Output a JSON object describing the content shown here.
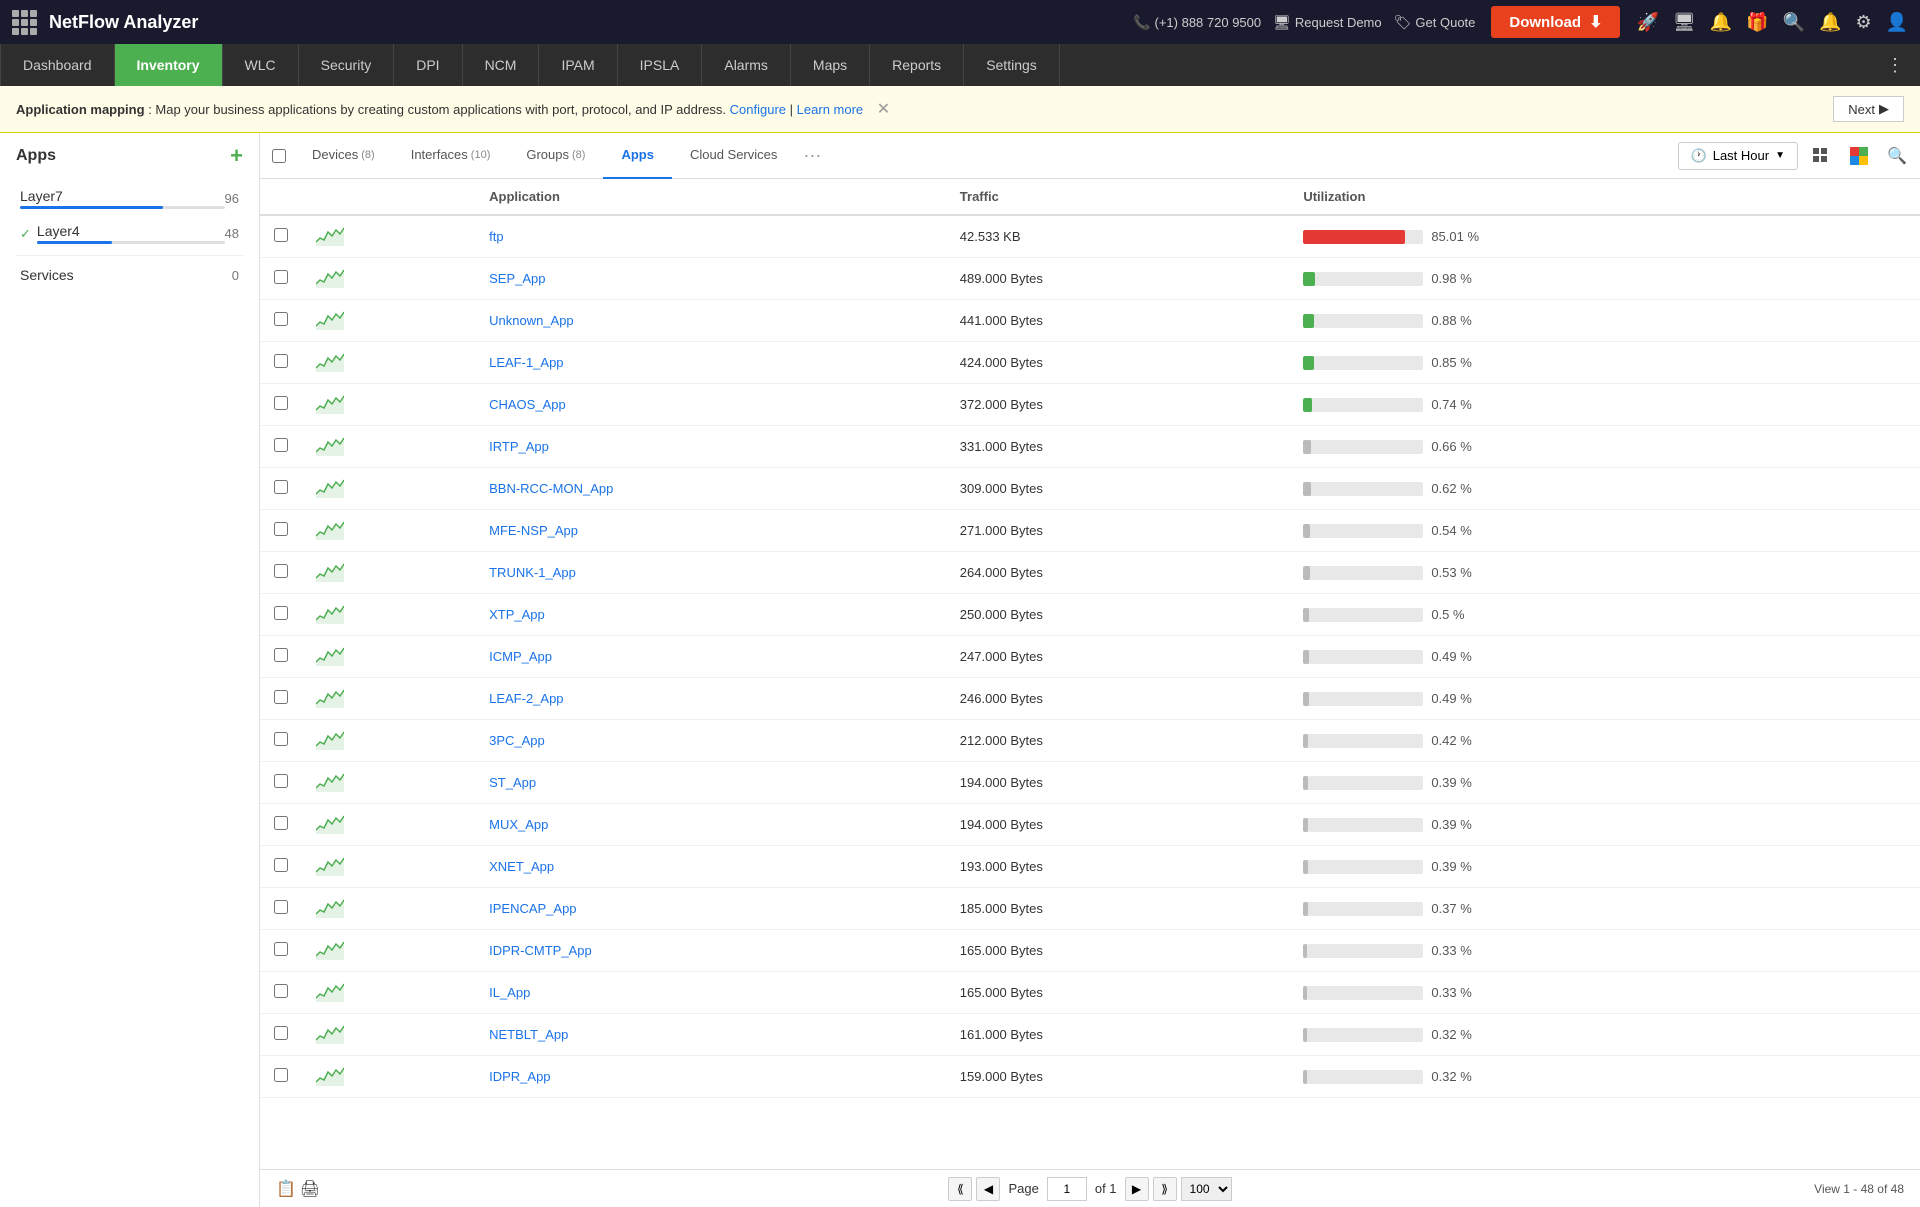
{
  "topbar": {
    "logo_text": "NetFlow Analyzer",
    "phone": "(+1) 888 720 9500",
    "demo_label": "Request Demo",
    "quote_label": "Get Quote",
    "download_label": "Download",
    "icons": [
      "rocket",
      "monitor",
      "bell-outline",
      "gift",
      "search",
      "bell",
      "gear",
      "user"
    ]
  },
  "navbar": {
    "items": [
      {
        "label": "Dashboard",
        "active": false
      },
      {
        "label": "Inventory",
        "active": true
      },
      {
        "label": "WLC",
        "active": false
      },
      {
        "label": "Security",
        "active": false
      },
      {
        "label": "DPI",
        "active": false
      },
      {
        "label": "NCM",
        "active": false
      },
      {
        "label": "IPAM",
        "active": false
      },
      {
        "label": "IPSLA",
        "active": false
      },
      {
        "label": "Alarms",
        "active": false
      },
      {
        "label": "Maps",
        "active": false
      },
      {
        "label": "Reports",
        "active": false
      },
      {
        "label": "Settings",
        "active": false
      }
    ]
  },
  "banner": {
    "bold": "Application mapping",
    "text": ": Map your business applications by creating custom applications with port, protocol, and IP address.",
    "configure": "Configure",
    "learn_more": "Learn more",
    "next_label": "Next"
  },
  "sidebar": {
    "title": "Apps",
    "add_tooltip": "+",
    "items": [
      {
        "label": "Layer7",
        "count": 96,
        "checked": false,
        "bar_pct": 70,
        "bar_color": "#1a73e8"
      },
      {
        "label": "Layer4",
        "count": 48,
        "checked": true,
        "bar_pct": 40,
        "bar_color": "#1a73e8"
      },
      {
        "label": "Services",
        "count": 0,
        "checked": false,
        "bar_pct": 0,
        "bar_color": "#1a73e8"
      }
    ]
  },
  "tabs": {
    "items": [
      {
        "label": "Devices",
        "badge": "(8)",
        "active": false
      },
      {
        "label": "Interfaces",
        "badge": "(10)",
        "active": false
      },
      {
        "label": "Groups",
        "badge": "(8)",
        "active": false
      },
      {
        "label": "Apps",
        "badge": "",
        "active": true
      },
      {
        "label": "Cloud Services",
        "badge": "",
        "active": false
      }
    ],
    "last_hour": "Last Hour",
    "more_label": "···"
  },
  "table": {
    "headers": [
      "",
      "",
      "Application",
      "Traffic",
      "Utilization"
    ],
    "rows": [
      {
        "name": "ftp",
        "traffic": "42.533 KB",
        "util_pct": 85.01,
        "util_label": "85.01 %",
        "bar_color": "#e53935"
      },
      {
        "name": "SEP_App",
        "traffic": "489.000 Bytes",
        "util_pct": 0.98,
        "util_label": "0.98 %",
        "bar_color": "#4caf50"
      },
      {
        "name": "Unknown_App",
        "traffic": "441.000 Bytes",
        "util_pct": 0.88,
        "util_label": "0.88 %",
        "bar_color": "#4caf50"
      },
      {
        "name": "LEAF-1_App",
        "traffic": "424.000 Bytes",
        "util_pct": 0.85,
        "util_label": "0.85 %",
        "bar_color": "#4caf50"
      },
      {
        "name": "CHAOS_App",
        "traffic": "372.000 Bytes",
        "util_pct": 0.74,
        "util_label": "0.74 %",
        "bar_color": "#4caf50"
      },
      {
        "name": "IRTP_App",
        "traffic": "331.000 Bytes",
        "util_pct": 0.66,
        "util_label": "0.66 %",
        "bar_color": "#bbb"
      },
      {
        "name": "BBN-RCC-MON_App",
        "traffic": "309.000 Bytes",
        "util_pct": 0.62,
        "util_label": "0.62 %",
        "bar_color": "#bbb"
      },
      {
        "name": "MFE-NSP_App",
        "traffic": "271.000 Bytes",
        "util_pct": 0.54,
        "util_label": "0.54 %",
        "bar_color": "#bbb"
      },
      {
        "name": "TRUNK-1_App",
        "traffic": "264.000 Bytes",
        "util_pct": 0.53,
        "util_label": "0.53 %",
        "bar_color": "#bbb"
      },
      {
        "name": "XTP_App",
        "traffic": "250.000 Bytes",
        "util_pct": 0.5,
        "util_label": "0.5 %",
        "bar_color": "#bbb"
      },
      {
        "name": "ICMP_App",
        "traffic": "247.000 Bytes",
        "util_pct": 0.49,
        "util_label": "0.49 %",
        "bar_color": "#bbb"
      },
      {
        "name": "LEAF-2_App",
        "traffic": "246.000 Bytes",
        "util_pct": 0.49,
        "util_label": "0.49 %",
        "bar_color": "#bbb"
      },
      {
        "name": "3PC_App",
        "traffic": "212.000 Bytes",
        "util_pct": 0.42,
        "util_label": "0.42 %",
        "bar_color": "#bbb"
      },
      {
        "name": "ST_App",
        "traffic": "194.000 Bytes",
        "util_pct": 0.39,
        "util_label": "0.39 %",
        "bar_color": "#bbb"
      },
      {
        "name": "MUX_App",
        "traffic": "194.000 Bytes",
        "util_pct": 0.39,
        "util_label": "0.39 %",
        "bar_color": "#bbb"
      },
      {
        "name": "XNET_App",
        "traffic": "193.000 Bytes",
        "util_pct": 0.39,
        "util_label": "0.39 %",
        "bar_color": "#bbb"
      },
      {
        "name": "IPENCAP_App",
        "traffic": "185.000 Bytes",
        "util_pct": 0.37,
        "util_label": "0.37 %",
        "bar_color": "#bbb"
      },
      {
        "name": "IDPR-CMTP_App",
        "traffic": "165.000 Bytes",
        "util_pct": 0.33,
        "util_label": "0.33 %",
        "bar_color": "#bbb"
      },
      {
        "name": "IL_App",
        "traffic": "165.000 Bytes",
        "util_pct": 0.33,
        "util_label": "0.33 %",
        "bar_color": "#bbb"
      },
      {
        "name": "NETBLT_App",
        "traffic": "161.000 Bytes",
        "util_pct": 0.32,
        "util_label": "0.32 %",
        "bar_color": "#bbb"
      },
      {
        "name": "IDPR_App",
        "traffic": "159.000 Bytes",
        "util_pct": 0.32,
        "util_label": "0.32 %",
        "bar_color": "#bbb"
      }
    ]
  },
  "pagination": {
    "page_label": "Page",
    "page_value": "1",
    "of_label": "of 1",
    "per_page_options": [
      "100"
    ],
    "per_page_value": "100",
    "view_text": "View 1 - 48 of 48"
  }
}
